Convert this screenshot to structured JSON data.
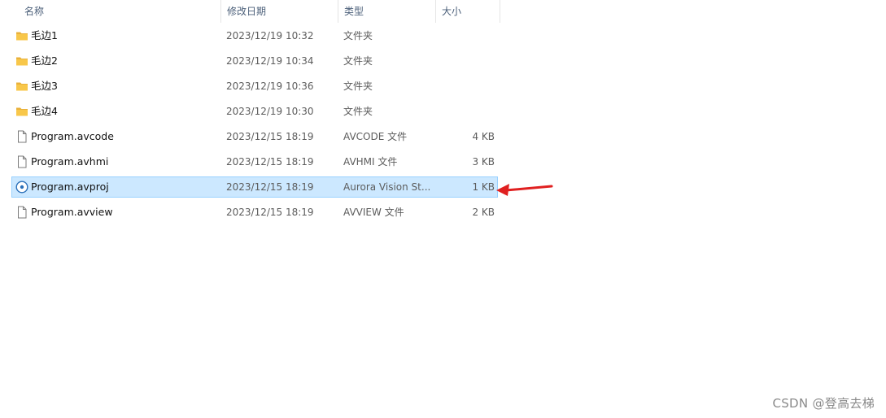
{
  "columns": {
    "name": "名称",
    "date": "修改日期",
    "type": "类型",
    "size": "大小"
  },
  "sort_indicator": "^",
  "files": [
    {
      "icon": "folder-icon",
      "name": "毛边1",
      "date": "2023/12/19 10:32",
      "type": "文件夹",
      "size": "",
      "selected": false
    },
    {
      "icon": "folder-icon",
      "name": "毛边2",
      "date": "2023/12/19 10:34",
      "type": "文件夹",
      "size": "",
      "selected": false
    },
    {
      "icon": "folder-icon",
      "name": "毛边3",
      "date": "2023/12/19 10:36",
      "type": "文件夹",
      "size": "",
      "selected": false
    },
    {
      "icon": "folder-icon",
      "name": "毛边4",
      "date": "2023/12/19 10:30",
      "type": "文件夹",
      "size": "",
      "selected": false
    },
    {
      "icon": "file-icon",
      "name": "Program.avcode",
      "date": "2023/12/15 18:19",
      "type": "AVCODE 文件",
      "size": "4 KB",
      "selected": false
    },
    {
      "icon": "file-icon",
      "name": "Program.avhmi",
      "date": "2023/12/15 18:19",
      "type": "AVHMI 文件",
      "size": "3 KB",
      "selected": false
    },
    {
      "icon": "aurora-project-icon",
      "name": "Program.avproj",
      "date": "2023/12/15 18:19",
      "type": "Aurora Vision St...",
      "size": "1 KB",
      "selected": true
    },
    {
      "icon": "file-icon",
      "name": "Program.avview",
      "date": "2023/12/15 18:19",
      "type": "AVVIEW 文件",
      "size": "2 KB",
      "selected": false
    }
  ],
  "annotation": {
    "icon": "red-arrow-icon",
    "color": "#e02020"
  },
  "watermark": "CSDN @登高去梯",
  "colors": {
    "selection_bg": "#cce8ff",
    "selection_border": "#99d1ff",
    "folder": "#f8c74a"
  }
}
